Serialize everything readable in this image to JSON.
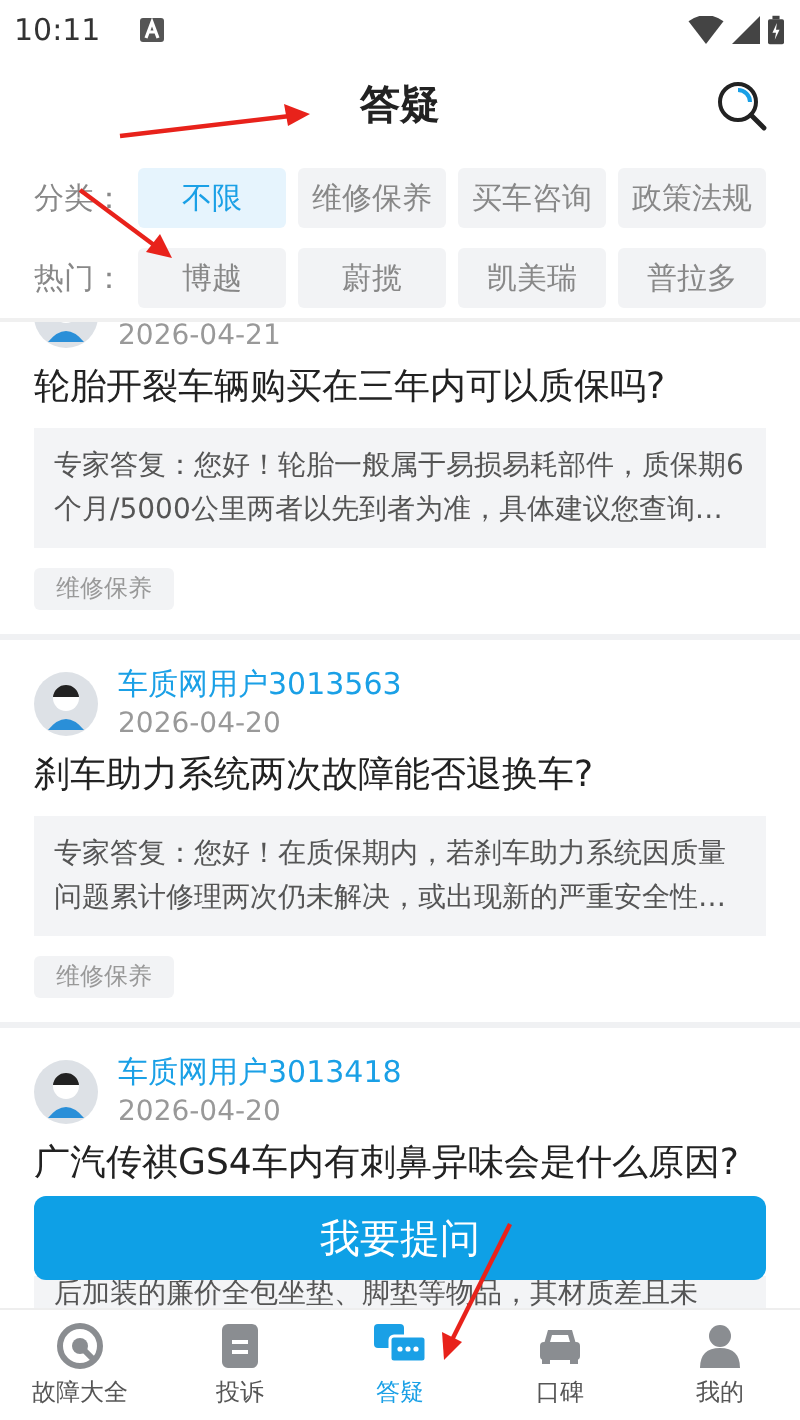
{
  "status_bar": {
    "time": "10:11"
  },
  "header": {
    "title": "答疑"
  },
  "filters": [
    {
      "label": "分类：",
      "options": [
        {
          "label": "不限",
          "selected": true
        },
        {
          "label": "维修保养",
          "selected": false
        },
        {
          "label": "买车咨询",
          "selected": false
        },
        {
          "label": "政策法规",
          "selected": false
        }
      ]
    },
    {
      "label": "热门：",
      "options": [
        {
          "label": "博越",
          "selected": false
        },
        {
          "label": "蔚揽",
          "selected": false
        },
        {
          "label": "凯美瑞",
          "selected": false
        },
        {
          "label": "普拉多",
          "selected": false
        }
      ]
    }
  ],
  "questions": [
    {
      "date": "2026-04-21",
      "question": "轮胎开裂车辆购买在三年内可以质保吗?",
      "answer": "专家答复：您好！轮胎一般属于易损易耗部件，质保期6个月/5000公里两者以先到者为准，具体建议您查询…",
      "tag": "维修保养"
    },
    {
      "user": "车质网用户3013563",
      "date": "2026-04-20",
      "question": "刹车助力系统两次故障能否退换车?",
      "answer": "专家答复：您好！在质保期内，若刹车助力系统因质量问题累计修理两次仍未解决，或出现新的严重安全性…",
      "tag": "维修保养"
    },
    {
      "user": "车质网用户3013418",
      "date": "2026-04-20",
      "question": "广汽传祺GS4车内有刺鼻异味会是什么原因?",
      "answer": "后加装的廉价全包坐垫、脚垫等物品，其材质差且未"
    }
  ],
  "ask_button": {
    "label": "我要提问"
  },
  "nav": [
    {
      "label": "故障大全",
      "kind": "wrench",
      "selected": false
    },
    {
      "label": "投诉",
      "kind": "doc",
      "selected": false
    },
    {
      "label": "答疑",
      "kind": "chat",
      "selected": true
    },
    {
      "label": "口碑",
      "kind": "car",
      "selected": false
    },
    {
      "label": "我的",
      "kind": "person",
      "selected": false
    }
  ]
}
